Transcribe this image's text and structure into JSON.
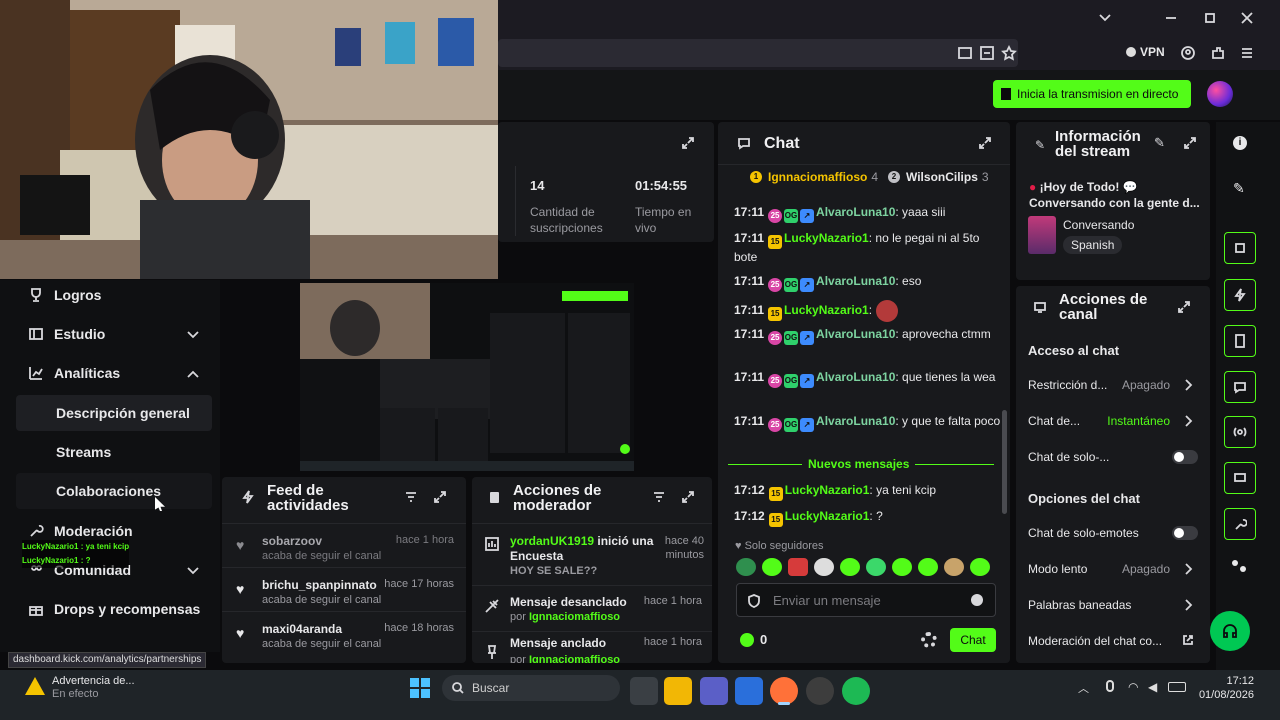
{
  "browser": {
    "vpn_label": "VPN"
  },
  "header": {
    "go_live_label": "Inicia la transmision en directo"
  },
  "stats": {
    "subs_value": "14",
    "subs_label": "Cantidad de suscripciones",
    "time_value": "01:54:55",
    "time_label": "Tiempo en vivo"
  },
  "sidebar": {
    "items": [
      {
        "label": "Logros"
      },
      {
        "label": "Estudio"
      },
      {
        "label": "Analíticas"
      },
      {
        "label": "Descripción general"
      },
      {
        "label": "Streams"
      },
      {
        "label": "Colaboraciones"
      },
      {
        "label": "Moderación"
      },
      {
        "label": "Comunidad"
      },
      {
        "label": "Drops y recompensas"
      }
    ],
    "overlay_lines": [
      "LuckyNazario1 : ya teni kcip",
      "LuckyNazario1 : ?"
    ]
  },
  "status_url": "dashboard.kick.com/analytics/partnerships",
  "chat": {
    "title": "Chat",
    "top_gifters": [
      {
        "name": "Ignnaciomaffioso",
        "count": "4"
      },
      {
        "name": "WilsonCilips",
        "count": "3"
      }
    ],
    "messages": [
      {
        "time": "17:11",
        "user": "AlvaroLuna10",
        "text": ": yaaa siii"
      },
      {
        "time": "17:11",
        "user": "LuckyNazario1",
        "text": ": no le pegai ni al 5to bote"
      },
      {
        "time": "17:11",
        "user": "AlvaroLuna10",
        "text": ": eso"
      },
      {
        "time": "17:11",
        "user": "LuckyNazario1",
        "text": ":"
      },
      {
        "time": "17:11",
        "user": "AlvaroLuna10",
        "text": ": aprovecha ctmm"
      },
      {
        "time": "17:11",
        "user": "AlvaroLuna10",
        "text": ": que tienes la wea"
      },
      {
        "time": "17:11",
        "user": "AlvaroLuna10",
        "text": ": y que te falta poco"
      },
      {
        "time": "17:12",
        "user": "LuckyNazario1",
        "text": ": ya teni kcip"
      },
      {
        "time": "17:12",
        "user": "LuckyNazario1",
        "text": ": ?"
      }
    ],
    "new_messages_label": "Nuevos mensajes",
    "followers_only": "Solo seguidores",
    "input_placeholder": "Enviar un mensaje",
    "points": "0",
    "send_label": "Chat"
  },
  "feed": {
    "title": "Feed de actividades",
    "rows": [
      {
        "user": "sobarzoov",
        "when": "hace 1 hora",
        "action": "acaba de seguir el canal"
      },
      {
        "user": "brichu_spanpinnato",
        "when": "hace 17 horas",
        "action": "acaba de seguir el canal"
      },
      {
        "user": "maxi04aranda",
        "when": "hace 18 horas",
        "action": "acaba de seguir el canal"
      }
    ]
  },
  "modactions": {
    "title": "Acciones de moderador",
    "rows": [
      {
        "title_user": "yordanUK1919",
        "title_rest": " inició una Encuesta",
        "when": "hace 40 minutos",
        "detail": "HOY SE SALE??"
      },
      {
        "title_user": "",
        "title_rest": "Mensaje desanclado",
        "when": "hace 1 hora",
        "detail_prefix": "por ",
        "detail_user": "Ignnaciomaffioso"
      },
      {
        "title_user": "",
        "title_rest": "Mensaje anclado",
        "when": "hace 1 hora",
        "detail_prefix": "por ",
        "detail_user": "Ignnaciomaffioso"
      }
    ]
  },
  "streaminfo": {
    "title": "Información del stream",
    "stream_title": "¡Hoy de Todo! 💬 Conversando con la gente d...",
    "category": "Conversando",
    "language": "Spanish"
  },
  "channelactions": {
    "title": "Acciones de canal",
    "chat_access_heading": "Acceso al chat",
    "rows1": [
      {
        "label": "Restricción d...",
        "value": "Apagado"
      },
      {
        "label": "Chat de...",
        "value": "Instantáneo"
      },
      {
        "label": "Chat de solo-...",
        "value": ""
      }
    ],
    "options_heading": "Opciones del chat",
    "rows2": [
      {
        "label": "Chat de solo-emotes",
        "value": ""
      },
      {
        "label": "Modo lento",
        "value": "Apagado"
      },
      {
        "label": "Palabras baneadas",
        "value": ""
      },
      {
        "label": "Moderación del chat co...",
        "value": ""
      }
    ]
  },
  "taskbar": {
    "weather_title": "Advertencia de...",
    "weather_sub": "En efecto",
    "search_label": "Buscar",
    "time": "17:12",
    "date": "01/08/2026"
  },
  "colors": {
    "accent": "#53fc18",
    "panel": "#18191c",
    "background": "#0b0b0d"
  }
}
